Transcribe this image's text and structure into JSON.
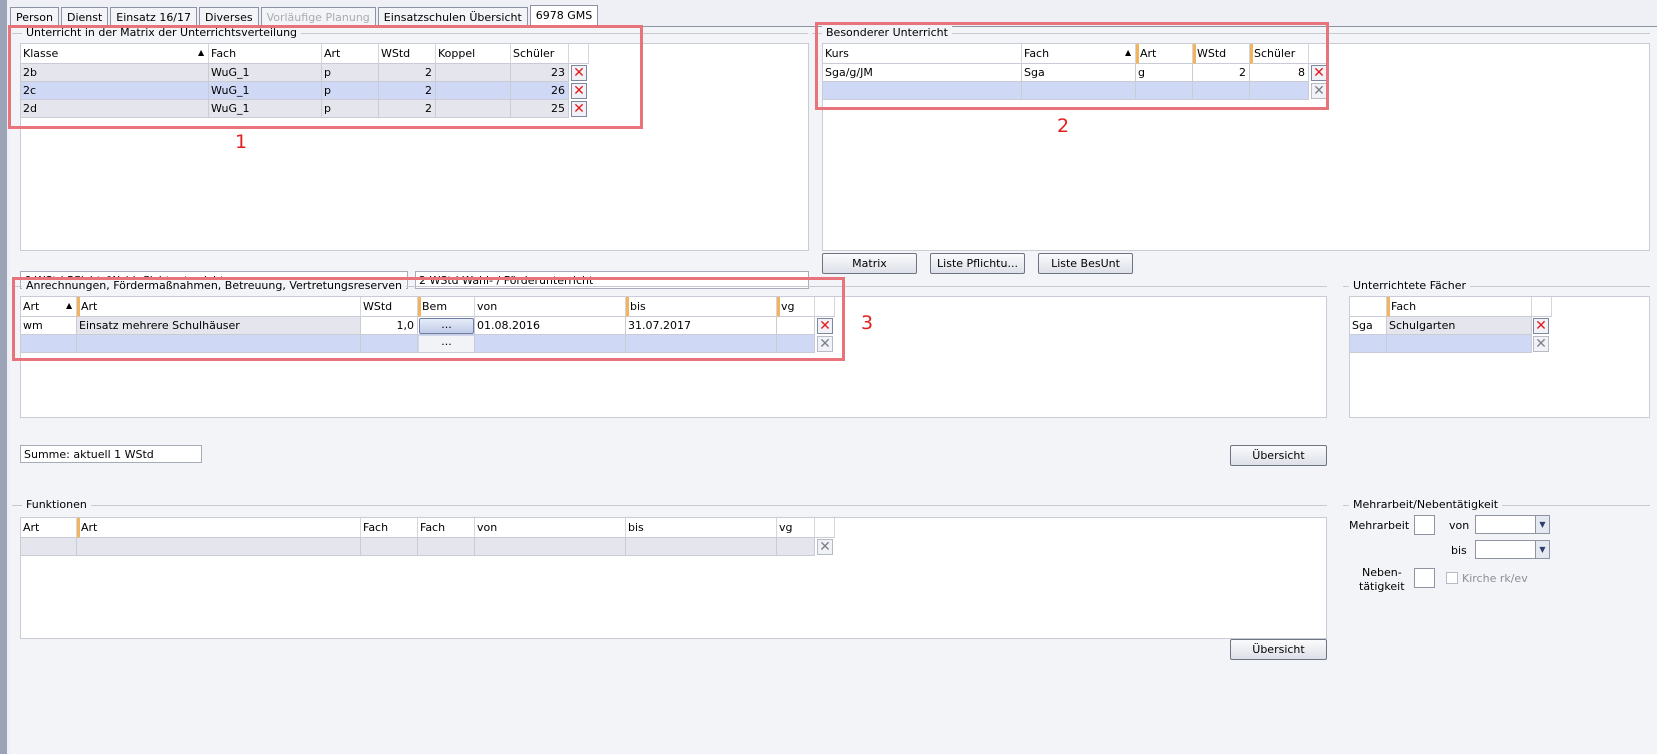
{
  "tabs": [
    {
      "label": "Person",
      "state": "normal"
    },
    {
      "label": "Dienst",
      "state": "normal"
    },
    {
      "label": "Einsatz 16/17",
      "state": "normal"
    },
    {
      "label": "Diverses",
      "state": "normal"
    },
    {
      "label": "Vorläufige Planung",
      "state": "disabled"
    },
    {
      "label": "Einsatzschulen Übersicht",
      "state": "normal"
    },
    {
      "label": "6978 GMS",
      "state": "active"
    }
  ],
  "matrix": {
    "title": "Unterricht in der Matrix der Unterrichtsverteilung",
    "headers": {
      "klasse": "Klasse",
      "fach": "Fach",
      "art": "Art",
      "wstd": "WStd",
      "koppel": "Koppel",
      "schueler": "Schüler"
    },
    "rows": [
      {
        "klasse": "2b",
        "fach": "WuG_1",
        "art": "p",
        "wstd": "2",
        "koppel": "",
        "schueler": "23"
      },
      {
        "klasse": "2c",
        "fach": "WuG_1",
        "art": "p",
        "wstd": "2",
        "koppel": "",
        "schueler": "26"
      },
      {
        "klasse": "2d",
        "fach": "WuG_1",
        "art": "p",
        "wstd": "2",
        "koppel": "",
        "schueler": "25"
      }
    ],
    "summary_pflicht": "6 WStd Pflicht-/Wahlpflichtunterricht",
    "summary_wahl": "2 WStd Wahl- / Förderunterricht"
  },
  "besonderer": {
    "title": "Besonderer Unterricht",
    "headers": {
      "kurs": "Kurs",
      "fach": "Fach",
      "art": "Art",
      "wstd": "WStd",
      "schueler": "Schüler"
    },
    "rows": [
      {
        "kurs": "Sga/g/JM",
        "fach": "Sga",
        "art": "g",
        "wstd": "2",
        "schueler": "8"
      }
    ],
    "buttons": {
      "matrix": "Matrix",
      "liste_pflicht": "Liste Pflichtu...",
      "liste_besunt": "Liste BesUnt"
    }
  },
  "anrechnungen": {
    "title": "Anrechnungen, Fördermaßnahmen, Betreuung, Vertretungsreserven",
    "headers": {
      "art1": "Art",
      "art2": "Art",
      "wstd": "WStd",
      "bem": "Bem",
      "von": "von",
      "bis": "bis",
      "vg": "vg"
    },
    "rows": [
      {
        "art1": "wm",
        "art2": "Einsatz mehrere Schulhäuser",
        "wstd": "1,0",
        "bem": "...",
        "von": "01.08.2016",
        "bis": "31.07.2017",
        "vg": ""
      }
    ],
    "empty_bem": "...",
    "summe": "Summe: aktuell 1 WStd",
    "uebersicht": "Übersicht"
  },
  "faecher": {
    "title": "Unterrichtete Fächer",
    "headers": {
      "code": "",
      "fach": "Fach"
    },
    "rows": [
      {
        "code": "Sga",
        "fach": "Schulgarten"
      }
    ]
  },
  "funktionen": {
    "title": "Funktionen",
    "headers": {
      "art1": "Art",
      "art2": "Art",
      "fach1": "Fach",
      "fach2": "Fach",
      "von": "von",
      "bis": "bis",
      "vg": "vg"
    },
    "uebersicht": "Übersicht"
  },
  "mehrarbeit": {
    "title": "Mehrarbeit/Nebentätigkeit",
    "mehrarbeit_label": "Mehrarbeit",
    "von_label": "von",
    "bis_label": "bis",
    "neben_label_1": "Neben-",
    "neben_label_2": "tätigkeit",
    "kirche_label": "Kirche rk/ev"
  },
  "annotations": [
    "1",
    "2",
    "3"
  ],
  "colors": {
    "annotation": "#e8737b",
    "annotation_text": "#e22020",
    "delete_red": "#e21b1b",
    "row_blue": "#cfd9f5",
    "row_gray": "#e5e6ed",
    "header_mark": "#f3b460"
  }
}
